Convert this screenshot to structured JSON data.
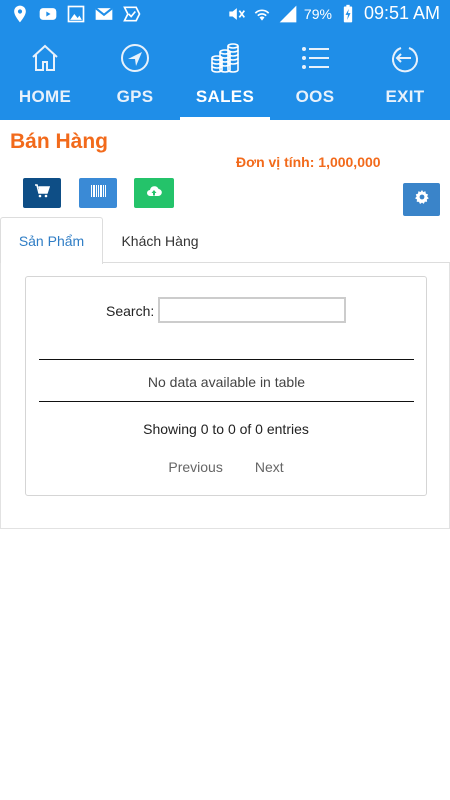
{
  "status_bar": {
    "battery_percent": "79%",
    "time": "09:51 AM",
    "left_icons": [
      "location-pin-icon",
      "youtube-icon",
      "gallery-icon",
      "gmail-icon",
      "app-check-icon"
    ],
    "right_icons": [
      "mute-icon",
      "wifi-icon",
      "signal-icon",
      "battery-charging-icon"
    ]
  },
  "nav": {
    "items": [
      {
        "label": "HOME",
        "icon": "home-icon",
        "active": false
      },
      {
        "label": "GPS",
        "icon": "compass-icon",
        "active": false
      },
      {
        "label": "SALES",
        "icon": "coins-icon",
        "active": true
      },
      {
        "label": "OOS",
        "icon": "list-icon",
        "active": false
      },
      {
        "label": "EXIT",
        "icon": "exit-icon",
        "active": false
      }
    ]
  },
  "page": {
    "title": "Bán Hàng",
    "unit": "Đơn vị tính: 1,000,000"
  },
  "toolbar": {
    "buttons": [
      "cart-icon",
      "barcode-icon",
      "cloud-upload-icon"
    ],
    "settings": "gear-icon"
  },
  "tabs": {
    "products": "Sản Phẩm",
    "customers": "Khách Hàng",
    "active": "products"
  },
  "table": {
    "search_label": "Search:",
    "search_value": "",
    "empty_message": "No data available in table",
    "info": "Showing 0 to 0 of 0 entries",
    "previous": "Previous",
    "next": "Next"
  },
  "colors": {
    "header_blue": "#1f8ee8",
    "accent_orange": "#f26a1b",
    "cart_button": "#0e4e86",
    "barcode_button": "#3a8ad6",
    "upload_button": "#24c36a",
    "settings_button": "#3a84c9",
    "active_tab_text": "#2f7dc5"
  }
}
